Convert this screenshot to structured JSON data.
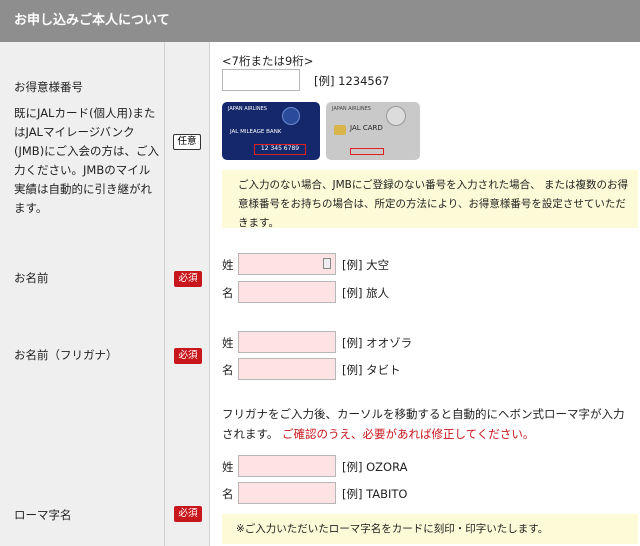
{
  "header": {
    "title": "お申し込みご本人について"
  },
  "member": {
    "label": "お得意様番号",
    "description": "既にJALカード(個人用)またはJALマイレージバンク(JMB)にご入会の方は、ご入力ください。JMBのマイル実績は自動的に引き継がれます。",
    "badge": "任意",
    "digits_note": "<7桁または9桁>",
    "example": "[例] 1234567",
    "card1_brand": "JAPAN AIRLINES",
    "card1_title": "JAL MILEAGE BANK",
    "card1_number": "12 345 6789",
    "card2_brand": "JAPAN AIRLINES",
    "card2_title": "JAL CARD",
    "notice": "ご入力のない場合、JMBにご登録のない番号を入力された場合、 または複数のお得意様番号をお持ちの場合は、所定の方法により、お得意様番号を設定させていただきます。"
  },
  "name": {
    "label": "お名前",
    "badge": "必須",
    "sei_label": "姓",
    "sei_example": "[例] 大空",
    "mei_label": "名",
    "mei_example": "[例] 旅人"
  },
  "furigana": {
    "label": "お名前（フリガナ）",
    "badge": "必須",
    "sei_label": "姓",
    "sei_example": "[例] オオゾラ",
    "mei_label": "名",
    "mei_example": "[例] タビト"
  },
  "romaji": {
    "label": "ローマ字名",
    "badge": "必須",
    "instruction": "フリガナをご入力後、カーソルを移動すると自動的にヘボン式ローマ字が入力されます。",
    "instruction_red": "ご確認のうえ、必要があれば修正してください。",
    "sei_label": "姓",
    "sei_example": "[例] OZORA",
    "mei_label": "名",
    "mei_example": "[例] TABITO",
    "notice": "※ご入力いただいたローマ字名をカードに刻印・印字いたします。"
  },
  "colors": {
    "header_bg": "#8e8e8e",
    "required": "#c8161d",
    "input_pink": "#fde3e3",
    "notice_bg": "#fdfad7"
  }
}
